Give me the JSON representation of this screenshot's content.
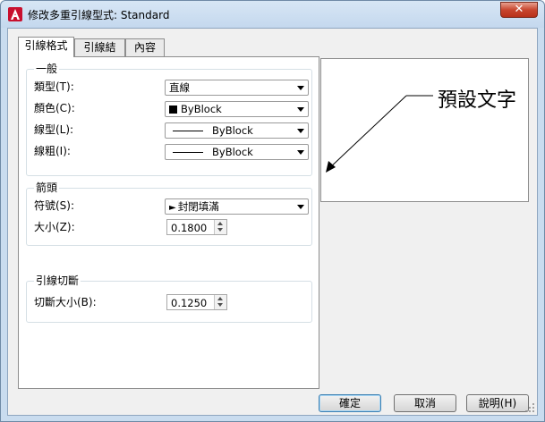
{
  "window": {
    "title": "修改多重引線型式: Standard",
    "close_label": "✕"
  },
  "tabs": [
    {
      "label": "引線格式",
      "active": true
    },
    {
      "label": "引線結構",
      "active": false
    },
    {
      "label": "內容",
      "active": false
    }
  ],
  "general": {
    "title": "一般",
    "type_label": "類型(T):",
    "type_value": "直線",
    "color_label": "顏色(C):",
    "color_value": "ByBlock",
    "linetype_label": "線型(L):",
    "linetype_value": "ByBlock",
    "lineweight_label": "線粗(I):",
    "lineweight_value": "ByBlock"
  },
  "arrowhead": {
    "title": "箭頭",
    "symbol_label": "符號(S):",
    "symbol_value": "封閉填滿",
    "size_label": "大小(Z):",
    "size_value": "0.1800"
  },
  "leader_break": {
    "title": "引線切斷",
    "break_size_label": "切斷大小(B):",
    "break_size_value": "0.1250"
  },
  "preview": {
    "text": "預設文字"
  },
  "buttons": {
    "ok": "確定",
    "cancel": "取消",
    "help": "說明(H)"
  },
  "colors": {
    "titlebar": "#c9dcef",
    "client_bg": "#f0f0f0",
    "close_red": "#c8462f"
  }
}
